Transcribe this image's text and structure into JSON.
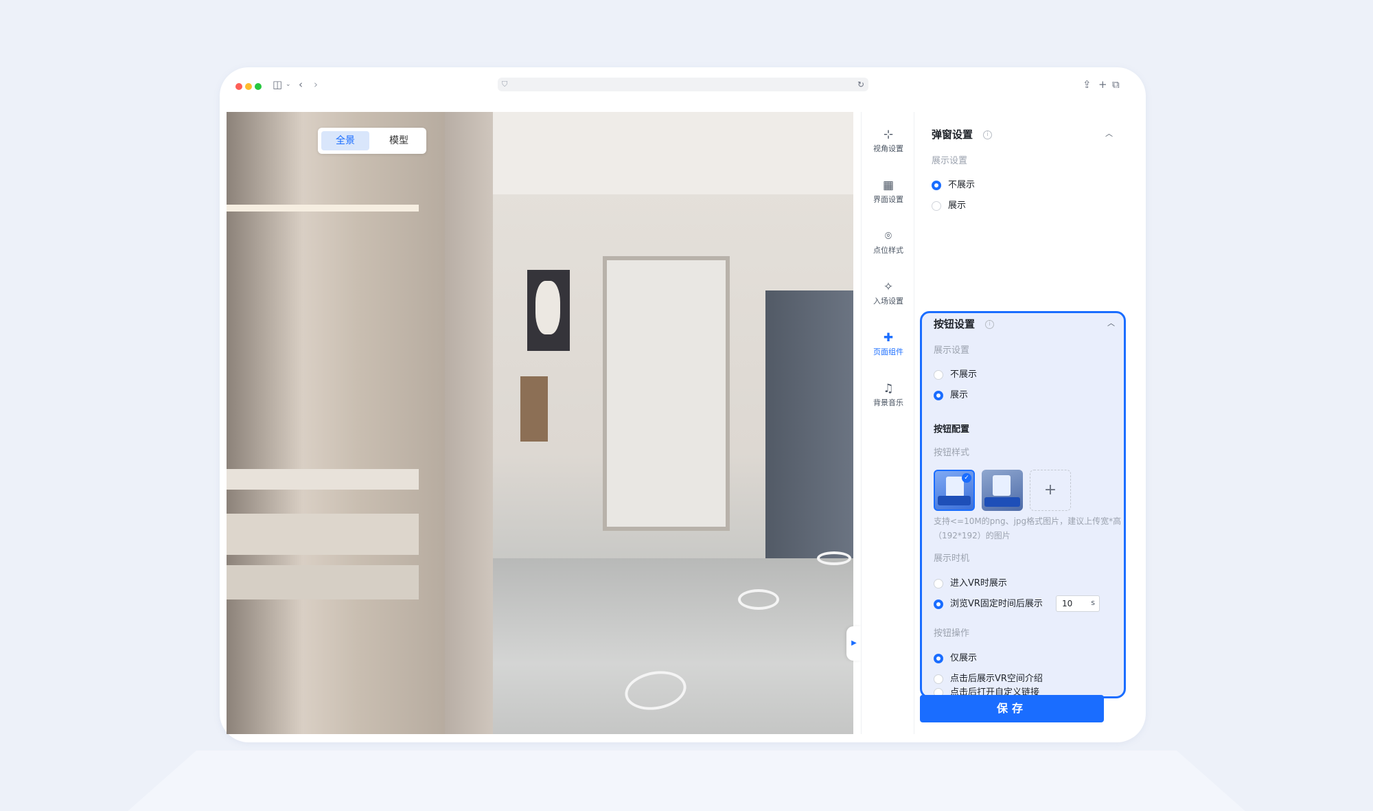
{
  "viewer": {
    "tabs": [
      {
        "label": "全景",
        "active": true
      },
      {
        "label": "模型",
        "active": false
      }
    ]
  },
  "sidenav": [
    {
      "label": "视角设置",
      "icon": "focus-icon",
      "active": false
    },
    {
      "label": "界面设置",
      "icon": "layout-icon",
      "active": false
    },
    {
      "label": "点位样式",
      "icon": "location-pin-icon",
      "active": false
    },
    {
      "label": "入场设置",
      "icon": "sparkle-icon",
      "active": false
    },
    {
      "label": "页面组件",
      "icon": "puzzle-icon",
      "active": true
    },
    {
      "label": "背景音乐",
      "icon": "music-note-icon",
      "active": false
    }
  ],
  "popup_section": {
    "title": "弹窗设置",
    "display_label": "展示设置",
    "options": [
      {
        "label": "不展示",
        "checked": true
      },
      {
        "label": "展示",
        "checked": false
      }
    ]
  },
  "button_section": {
    "title": "按钮设置",
    "display_label": "展示设置",
    "options": [
      {
        "label": "不展示",
        "checked": false
      },
      {
        "label": "展示",
        "checked": true
      }
    ],
    "config_title": "按钮配置",
    "style_label": "按钮样式",
    "thumbnails": [
      {
        "icon": "vr-card-icon",
        "selected": true
      },
      {
        "icon": "contact-card-icon",
        "selected": false
      }
    ],
    "add_icon": "plus-icon",
    "hint": "支持<=10M的png、jpg格式图片，建议上传宽*高（192*192）的图片",
    "timing_label": "展示时机",
    "timing_options": [
      {
        "label": "进入VR时展示",
        "checked": false
      },
      {
        "label": "浏览VR固定时间后展示",
        "checked": true
      }
    ],
    "timing_value": "10",
    "timing_unit": "s",
    "action_label": "按钮操作",
    "action_options": [
      {
        "label": "仅展示",
        "checked": true
      },
      {
        "label": "点击后展示VR空间介绍",
        "checked": false
      },
      {
        "label": "点击后打开自定义链接",
        "checked": false
      }
    ]
  },
  "save_label": "保存",
  "colors": {
    "accent": "#1a6dff",
    "page_bg": "#edf1f9",
    "highlight_bg": "#e9eefc"
  }
}
